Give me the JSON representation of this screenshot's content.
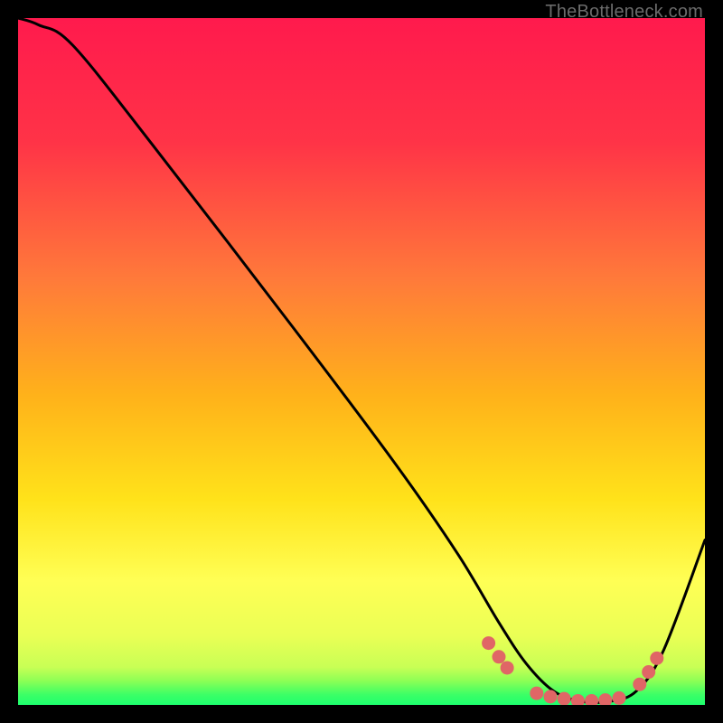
{
  "attribution": "TheBottleneck.com",
  "colors": {
    "bg_black": "#000000",
    "grad_top": "#ff1a4d",
    "grad_mid1": "#ff6e3a",
    "grad_mid2": "#ffd21a",
    "grad_mid3": "#ffff66",
    "grad_mid4": "#e8ff66",
    "grad_bottom": "#2cff6a",
    "curve": "#000000",
    "dot": "#e06666",
    "attribution": "#6b6b6b"
  },
  "chart_data": {
    "type": "line",
    "title": "",
    "xlabel": "",
    "ylabel": "",
    "xlim": [
      0,
      100
    ],
    "ylim": [
      0,
      100
    ],
    "grid": false,
    "series": [
      {
        "name": "bottleneck-curve",
        "x": [
          0,
          3,
          8,
          20,
          40,
          55,
          64,
          70,
          74,
          78,
          82,
          86,
          90,
          94,
          100
        ],
        "y": [
          100,
          99,
          96,
          81,
          55,
          35,
          22,
          12,
          6,
          2,
          0.5,
          0.5,
          2,
          8,
          24
        ]
      }
    ],
    "dots": [
      {
        "x": 68.5,
        "y": 9.0
      },
      {
        "x": 70.0,
        "y": 7.0
      },
      {
        "x": 71.2,
        "y": 5.4
      },
      {
        "x": 75.5,
        "y": 1.7
      },
      {
        "x": 77.5,
        "y": 1.2
      },
      {
        "x": 79.5,
        "y": 0.9
      },
      {
        "x": 81.5,
        "y": 0.6
      },
      {
        "x": 83.5,
        "y": 0.6
      },
      {
        "x": 85.5,
        "y": 0.7
      },
      {
        "x": 87.5,
        "y": 1.0
      },
      {
        "x": 90.5,
        "y": 3.0
      },
      {
        "x": 91.8,
        "y": 4.8
      },
      {
        "x": 93.0,
        "y": 6.8
      }
    ],
    "gradient_stops": [
      {
        "offset": 0.0,
        "color": "#ff1a4d"
      },
      {
        "offset": 0.18,
        "color": "#ff3347"
      },
      {
        "offset": 0.38,
        "color": "#ff7a3a"
      },
      {
        "offset": 0.55,
        "color": "#ffb21a"
      },
      {
        "offset": 0.7,
        "color": "#ffe21a"
      },
      {
        "offset": 0.82,
        "color": "#ffff55"
      },
      {
        "offset": 0.9,
        "color": "#eaff55"
      },
      {
        "offset": 0.945,
        "color": "#c8ff55"
      },
      {
        "offset": 0.965,
        "color": "#8cff55"
      },
      {
        "offset": 0.985,
        "color": "#3cff66"
      },
      {
        "offset": 1.0,
        "color": "#1dff6e"
      }
    ]
  }
}
